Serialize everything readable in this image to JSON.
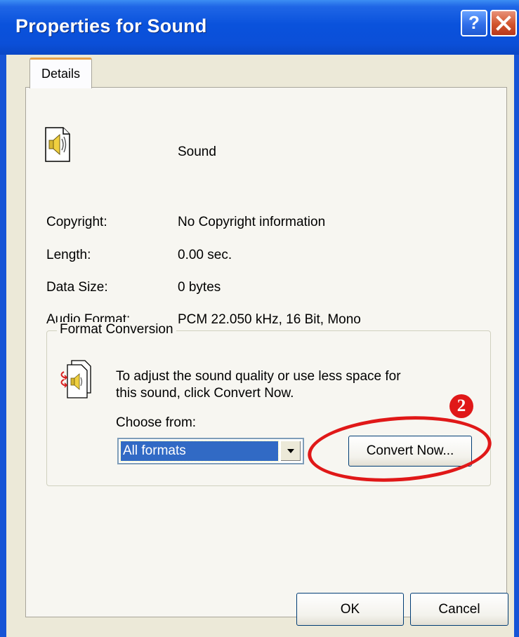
{
  "window": {
    "title": "Properties for Sound",
    "help_icon_glyph": "?",
    "close_icon": "close-icon"
  },
  "tabs": [
    {
      "label": "Details",
      "selected": true
    }
  ],
  "file": {
    "icon": "sound-file-icon",
    "name": "Sound"
  },
  "details": [
    {
      "label": "Copyright:",
      "value": "No Copyright information"
    },
    {
      "label": "Length:",
      "value": "0.00 sec."
    },
    {
      "label": "Data Size:",
      "value": "0 bytes"
    },
    {
      "label": "Audio Format:",
      "value": "PCM 22.050 kHz, 16 Bit, Mono"
    }
  ],
  "format_conversion": {
    "title": "Format Conversion",
    "icon": "sound-convert-icon",
    "description_line1": "To adjust the sound quality or use less space for",
    "description_line2": "this sound, click Convert Now.",
    "choose_label": "Choose from:",
    "selected_format": "All formats",
    "convert_button": "Convert Now..."
  },
  "annotation": {
    "step_number": "2",
    "color": "#e01818"
  },
  "buttons": {
    "ok": "OK",
    "cancel": "Cancel"
  },
  "colors": {
    "titlebar": "#0a52dc",
    "dialog_bg": "#ece9d8",
    "selection": "#316ac5"
  }
}
